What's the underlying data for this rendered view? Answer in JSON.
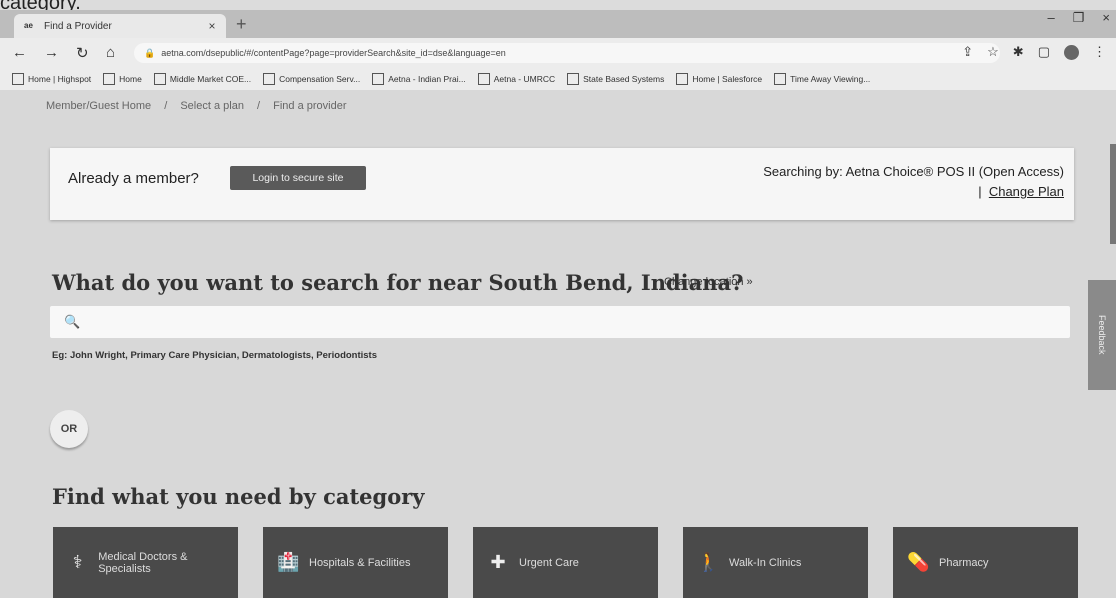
{
  "caption_fragment": "category.",
  "browser": {
    "tab_title": "Find a Provider",
    "tab_close": "×",
    "new_tab": "+",
    "url": "aetna.com/dsepublic/#/contentPage?page=providerSearch&site_id=dse&language=en",
    "window_controls": [
      "–",
      "❐",
      "×"
    ]
  },
  "bookmarks": [
    {
      "label": "Home | Highspot"
    },
    {
      "label": "Home"
    },
    {
      "label": "Middle Market COE..."
    },
    {
      "label": "Compensation Serv..."
    },
    {
      "label": "Aetna - Indian Prai..."
    },
    {
      "label": "Aetna - UMRCC"
    },
    {
      "label": "State Based Systems"
    },
    {
      "label": "Home | Salesforce"
    },
    {
      "label": "Time Away Viewing..."
    }
  ],
  "breadcrumb": [
    "Member/Guest Home",
    "/",
    "Select a plan",
    "/",
    "Find a provider"
  ],
  "member_box": {
    "question": "Already a member?",
    "login_button": "Login to secure site",
    "searching_by": "Searching by: Aetna Choice® POS II (Open Access)",
    "separator": "|",
    "change_plan": "Change Plan"
  },
  "search": {
    "headline": "What do you want to search for near South Bend, Indiana?",
    "change_location": "Change location  »",
    "placeholder": "",
    "example": "Eg: John Wright, Primary Care Physician, Dermatologists, Periodontists"
  },
  "or_label": "OR",
  "category_heading": "Find what you need by category",
  "categories": [
    {
      "label": "Medical Doctors & Specialists",
      "icon": "doctor-icon"
    },
    {
      "label": "Hospitals & Facilities",
      "icon": "hospital-icon"
    },
    {
      "label": "Urgent Care",
      "icon": "urgent-care-icon"
    },
    {
      "label": "Walk-In Clinics",
      "icon": "walk-in-icon"
    },
    {
      "label": "Pharmacy",
      "icon": "pharmacy-icon"
    }
  ],
  "feedback": "Feedback"
}
